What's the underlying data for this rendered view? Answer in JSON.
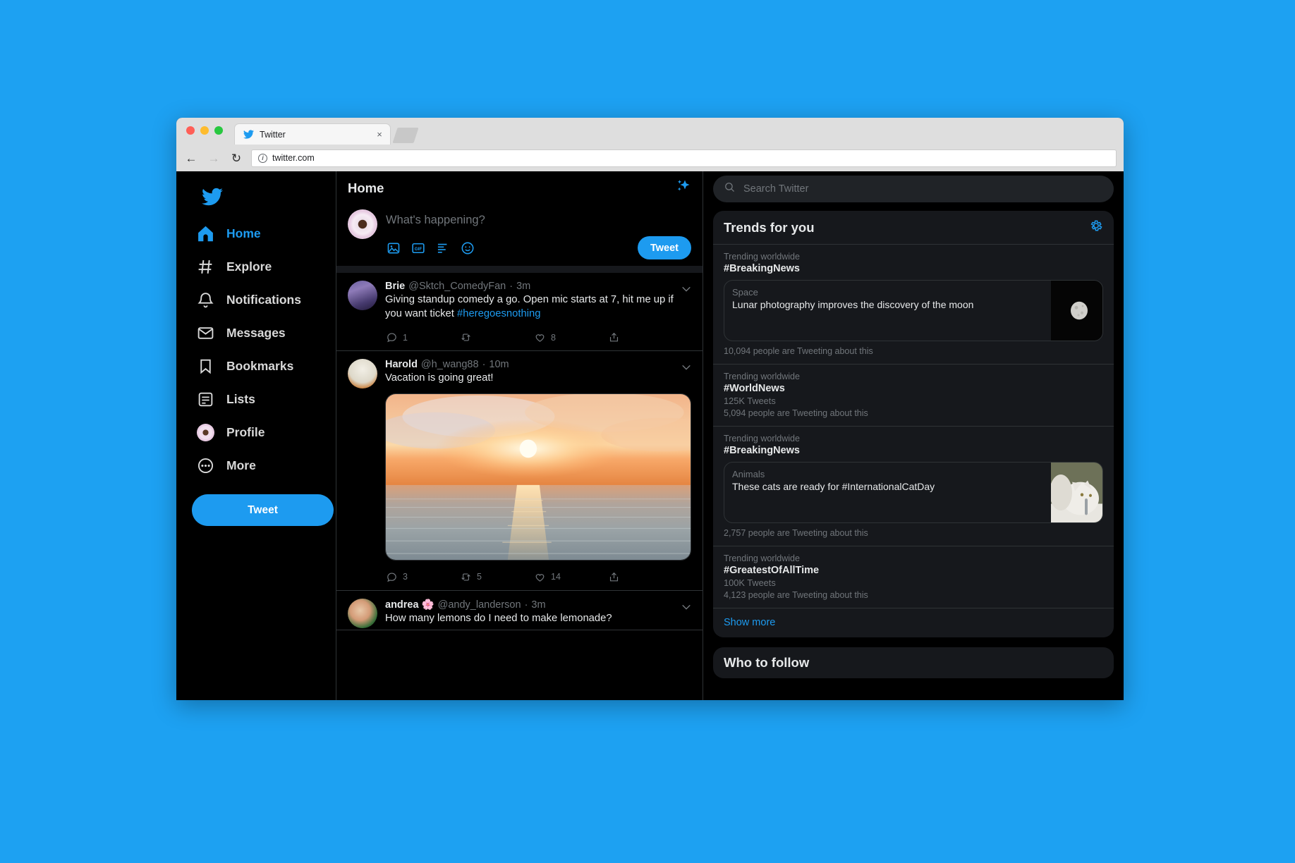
{
  "browser": {
    "tab_title": "Twitter",
    "tab_close": "×",
    "url": "twitter.com",
    "back_icon": "←",
    "forward_icon": "→",
    "reload_icon": "↻",
    "info_icon": "i"
  },
  "sidebar": {
    "logo_icon": "twitter-bird-icon",
    "items": [
      {
        "label": "Home",
        "icon": "home-icon",
        "active": true
      },
      {
        "label": "Explore",
        "icon": "hashtag-icon",
        "active": false
      },
      {
        "label": "Notifications",
        "icon": "bell-icon",
        "active": false
      },
      {
        "label": "Messages",
        "icon": "envelope-icon",
        "active": false
      },
      {
        "label": "Bookmarks",
        "icon": "bookmark-icon",
        "active": false
      },
      {
        "label": "Lists",
        "icon": "list-icon",
        "active": false
      },
      {
        "label": "Profile",
        "icon": "avatar-icon",
        "active": false
      },
      {
        "label": "More",
        "icon": "ellipsis-circle-icon",
        "active": false
      }
    ],
    "tweet_button": "Tweet"
  },
  "main": {
    "header_title": "Home",
    "sparkle_icon": "sparkle-icon",
    "compose": {
      "placeholder": "What's happening?",
      "tweet_button": "Tweet",
      "icons": [
        "image-icon",
        "gif-icon",
        "poll-icon",
        "emoji-icon"
      ]
    },
    "tweets": [
      {
        "name": "Brie",
        "handle": "@Sktch_ComedyFan",
        "separator": "·",
        "time": "3m",
        "text": "Giving standup comedy a go. Open mic starts at 7, hit me up if you want ticket ",
        "hashtag": "#heregoesnothing",
        "has_media": false,
        "replies": "1",
        "retweets": "",
        "likes": "8",
        "avatar": "brie-avatar"
      },
      {
        "name": "Harold",
        "handle": "@h_wang88",
        "separator": "·",
        "time": "10m",
        "text": "Vacation is going great!",
        "hashtag": "",
        "has_media": true,
        "media_alt": "sunset-over-ocean-photo",
        "replies": "3",
        "retweets": "5",
        "likes": "14",
        "avatar": "harold-avatar"
      },
      {
        "name": "andrea 🌸",
        "handle": "@andy_landerson",
        "separator": "·",
        "time": "3m",
        "text": "How many lemons do I need to make lemonade?",
        "hashtag": "",
        "has_media": false,
        "replies": "",
        "retweets": "",
        "likes": "",
        "avatar": "andrea-avatar"
      }
    ]
  },
  "right": {
    "search_placeholder": "Search Twitter",
    "search_icon": "search-icon",
    "trends_title": "Trends for you",
    "settings_icon": "gear-icon",
    "trends": [
      {
        "category": "Trending worldwide",
        "tag": "#BreakingNews",
        "tweet_count": "",
        "people": "10,094 people are Tweeting about this",
        "card": {
          "category": "Space",
          "headline": "Lunar photography improves the discovery of the moon",
          "image": "moon-thumbnail"
        }
      },
      {
        "category": "Trending worldwide",
        "tag": "#WorldNews",
        "tweet_count": "125K Tweets",
        "people": "5,094 people are Tweeting about this",
        "card": null
      },
      {
        "category": "Trending worldwide",
        "tag": "#BreakingNews",
        "tweet_count": "",
        "people": "2,757 people are Tweeting about this",
        "card": {
          "category": "Animals",
          "headline": "These cats are ready for #InternationalCatDay",
          "image": "cat-thumbnail"
        }
      },
      {
        "category": "Trending worldwide",
        "tag": "#GreatestOfAllTime",
        "tweet_count": "100K Tweets",
        "people": "4,123 people are Tweeting about this",
        "card": null
      }
    ],
    "show_more": "Show more",
    "who_to_follow_title": "Who to follow"
  },
  "colors": {
    "brand_blue": "#1d9bf0",
    "page_background": "#1DA1F2",
    "app_background": "#000000",
    "panel_background": "#16181c",
    "border": "#2f3336",
    "text_primary": "#e7e9ea",
    "text_secondary": "#71767b"
  }
}
